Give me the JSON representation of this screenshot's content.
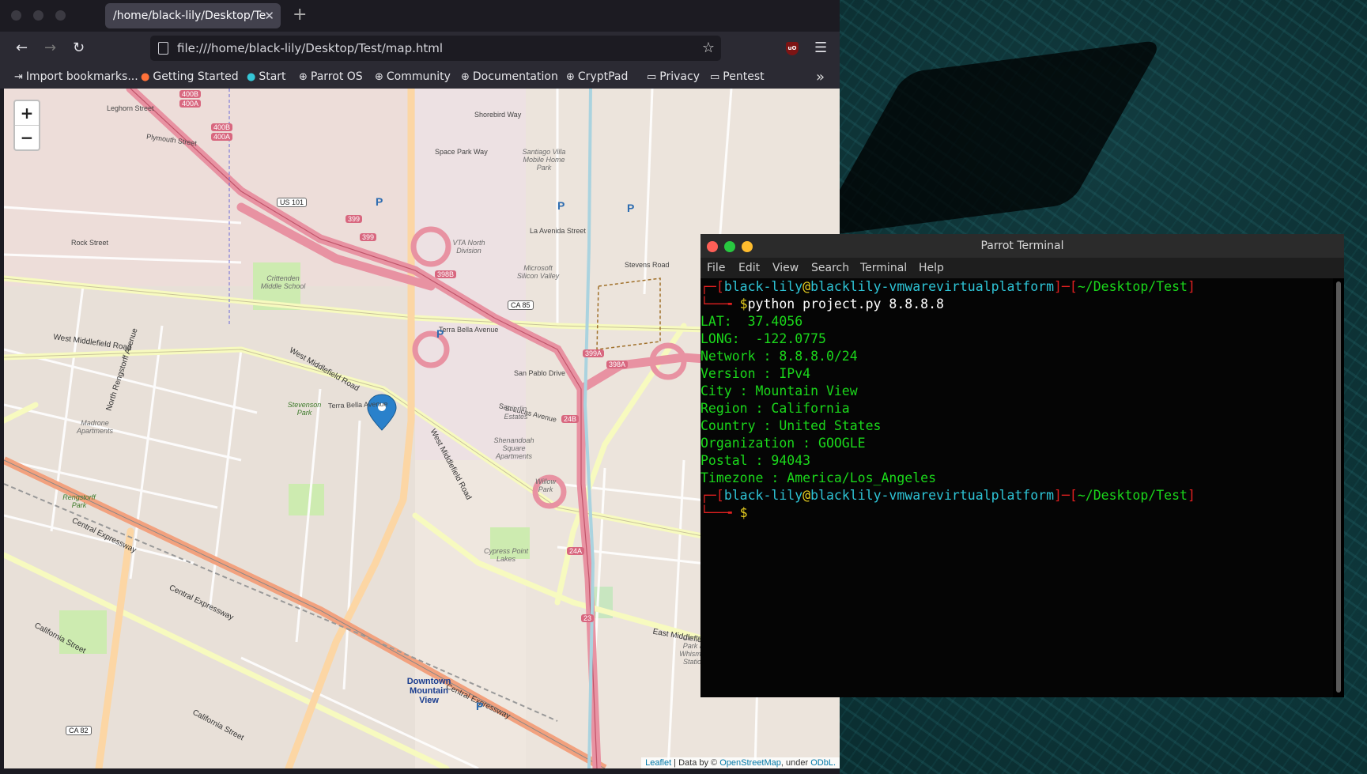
{
  "browser": {
    "tab_title": "/home/black-lily/Desktop/Te",
    "url": "file:///home/black-lily/Desktop/Test/map.html",
    "bookmarks": [
      {
        "label": "Import bookmarks...",
        "icon": "import-icon"
      },
      {
        "label": "Getting Started",
        "icon": "firefox-icon"
      },
      {
        "label": "Start",
        "icon": "parrot-icon"
      },
      {
        "label": "Parrot OS",
        "icon": "globe-icon"
      },
      {
        "label": "Community",
        "icon": "globe-icon"
      },
      {
        "label": "Documentation",
        "icon": "globe-icon"
      },
      {
        "label": "CryptPad",
        "icon": "globe-icon"
      },
      {
        "label": "Privacy",
        "icon": "folder-icon"
      },
      {
        "label": "Pentest",
        "icon": "folder-icon"
      }
    ]
  },
  "map": {
    "zoom_in": "+",
    "zoom_out": "−",
    "attribution": {
      "leaflet": "Leaflet",
      "data_by": " | Data by © ",
      "osm": "OpenStreetMap",
      "under": ", under ",
      "odbl": "ODbL."
    },
    "labels": {
      "west_middlefield": "West Middlefield Road",
      "west_middlefield_2": "West Middlefield Road",
      "west_middlefield_3": "West Middlefield Road",
      "central_expressway": "Central Expressway",
      "central_expressway_2": "Central Expressway",
      "central_expressway_3": "Central Expressway",
      "california_street": "California Street",
      "california_street_2": "California Street",
      "east_middlefield": "East Middlefield Road",
      "north_rengstorff": "North Rengstorff Avenue",
      "terra_bella": "Terra Bella Avenue",
      "terra_bella_2": "Terra Bella Avenue",
      "rock_street": "Rock Street",
      "plymouth_street": "Plymouth Street",
      "leghorn_street": "Leghorn Street",
      "la_avenida": "La Avenida Street",
      "space_park": "Space Park Way",
      "shorebird": "Shorebird Way",
      "stevens_creek": "Stevens Road",
      "san_pablo": "San Pablo Drive",
      "san_lucas": "San Lucas Avenue",
      "crittenden": "Crittenden Middle School",
      "vta": "VTA North Division",
      "microsoft": "Microsoft Silicon Valley",
      "santiago": "Santiago Villa Mobile Home Park",
      "stevenson_park": "Stevenson Park",
      "madrone": "Madrone Apartments",
      "rengstorff_park": "Rengstorff Park",
      "shenandoah": "Shenandoah Square Apartments",
      "willow_park": "Willow Park",
      "stierlin": "Stierlin Estates",
      "cypress_lakes": "Cypress Point Lakes",
      "downtown": "Downtown Mountain View",
      "central_park": "Central Park at Whisman Station"
    },
    "shields": {
      "us101": "US 101",
      "ca85": "CA 85",
      "ca82": "CA 82",
      "r399": "399",
      "r399b": "399",
      "r398b": "398B",
      "r399a": "399A",
      "r398a": "398A",
      "r24b": "24B",
      "r24a": "24A",
      "r23": "23",
      "r400b": "400B",
      "r400a": "400A",
      "r400b2": "400B",
      "r400a2": "400A"
    }
  },
  "terminal": {
    "title": "Parrot Terminal",
    "menu": [
      "File",
      "Edit",
      "View",
      "Search",
      "Terminal",
      "Help"
    ],
    "prompt": {
      "user": "black-lily",
      "at": "@",
      "host": "blacklily-vmwarevirtualplatform",
      "path": "~/Desktop/Test",
      "dollar": "$"
    },
    "command": "python project.py 8.8.8.8",
    "output": [
      "LAT:  37.4056",
      "LONG:  -122.0775",
      "Network : 8.8.8.0/24",
      "Version : IPv4",
      "City : Mountain View",
      "Region : California",
      "Country : United States",
      "Organization : GOOGLE",
      "Postal : 94043",
      "Timezone : America/Los_Angeles"
    ]
  },
  "colors": {
    "prompt_red": "#e02020",
    "prompt_cyan": "#2ec4d6",
    "output_green": "#1bd81b",
    "motorway": "#e892a2",
    "primary_road": "#fcd6a4",
    "secondary_road": "#f7fabf",
    "marker_blue": "#2a81cb"
  }
}
